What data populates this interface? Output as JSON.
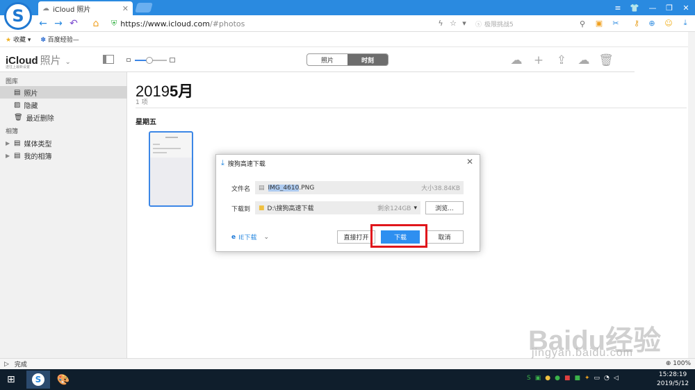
{
  "browser": {
    "tab_title": "iCloud 照片",
    "url_scheme": "https://",
    "url_host": "www.icloud.com",
    "url_path": "/#photos",
    "search_placeholder": "极限挑战5",
    "bookmarks": [
      "收藏",
      "百度经验—"
    ]
  },
  "icloud": {
    "app_title": "iCloud",
    "section": "照片",
    "subtitle": "送往上最新设置",
    "tabs": [
      "照片",
      "时刻"
    ],
    "active_tab": "时刻",
    "sidebar": {
      "library_header": "图库",
      "library_items": [
        "照片",
        "隐藏",
        "最近删除"
      ],
      "albums_header": "相簿",
      "album_items": [
        "媒体类型",
        "我的相簿"
      ]
    },
    "main": {
      "year": "2019",
      "month": "5月",
      "count": "1 项",
      "day": "星期五"
    }
  },
  "dialog": {
    "title": "搜狗高速下载",
    "filename_label": "文件名",
    "filename_selected": "IMG_4610",
    "filename_ext": ".PNG",
    "size": "大小38.84KB",
    "saveto_label": "下载到",
    "path": "D:\\搜狗高速下载",
    "remaining": "剩余124GB",
    "browse_button": "浏览...",
    "ie_download": "IE下载",
    "open_button": "直接打开",
    "download_button": "下载",
    "cancel_button": "取消"
  },
  "status": {
    "text": "完成",
    "zoom": "100%"
  },
  "watermark": {
    "brand": "Baidu经验",
    "url": "jingyan.baidu.com"
  },
  "taskbar": {
    "time": "15:28:19",
    "date": "2019/5/12"
  },
  "colors": {
    "chrome_blue": "#2a8ae0",
    "download_blue": "#2e8ff0",
    "highlight_red": "#e0161b",
    "taskbar": "#0f1e2c"
  }
}
